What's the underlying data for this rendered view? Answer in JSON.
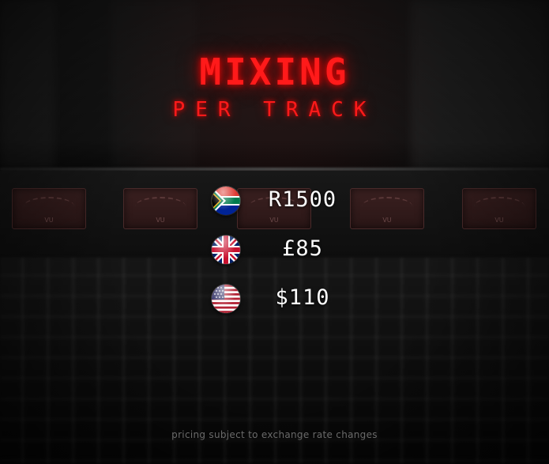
{
  "title": {
    "main": "MIXING",
    "sub": "PER TRACK"
  },
  "prices": [
    {
      "currency": "South Africa",
      "flag_icon": "south-africa-flag-icon",
      "amount": "R1500"
    },
    {
      "currency": "United Kingdom",
      "flag_icon": "uk-flag-icon",
      "amount": "£85"
    },
    {
      "currency": "United States",
      "flag_icon": "us-flag-icon",
      "amount": "$110"
    }
  ],
  "footnote": "pricing subject to exchange rate changes",
  "colors": {
    "title_red": "#ff1a1a",
    "price_white": "#ffffff",
    "footnote_gray": "#6a6a6a",
    "background": "#0b0b0b"
  }
}
